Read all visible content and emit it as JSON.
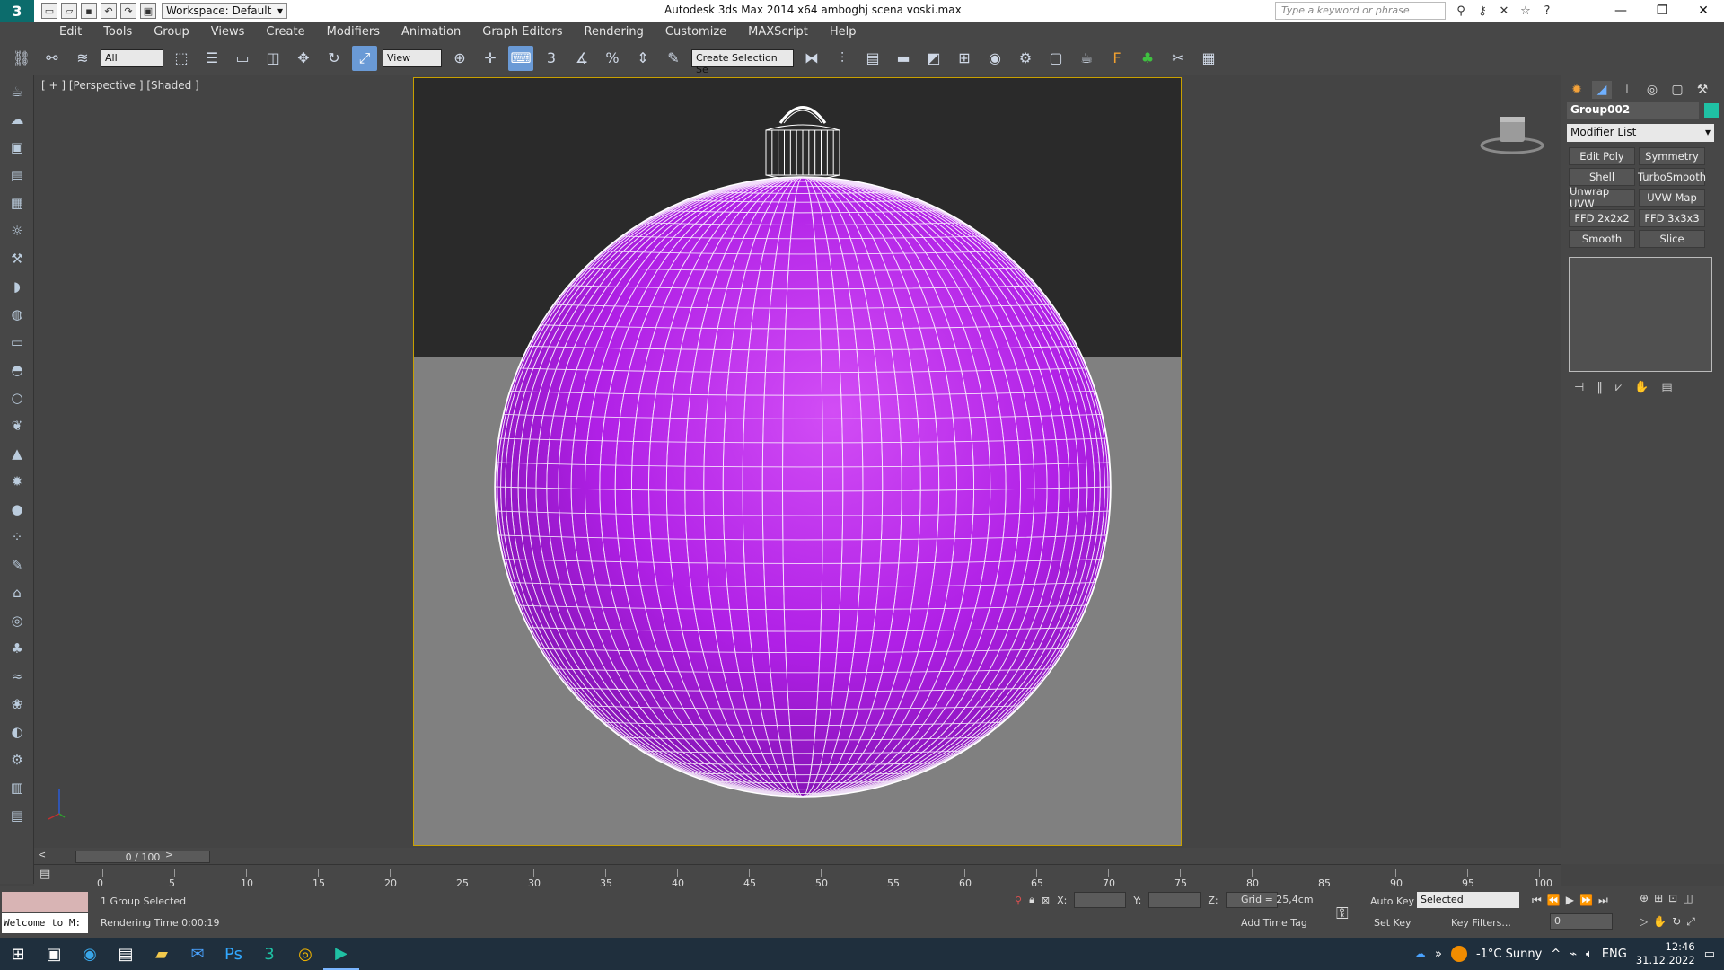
{
  "window": {
    "app_title": "Autodesk 3ds Max  2014 x64     amboghj  scena  voski.max",
    "workspace": "Workspace: Default",
    "search_placeholder": "Type a keyword or phrase"
  },
  "menu": [
    "Edit",
    "Tools",
    "Group",
    "Views",
    "Create",
    "Modifiers",
    "Animation",
    "Graph Editors",
    "Rendering",
    "Customize",
    "MAXScript",
    "Help"
  ],
  "toolbar": {
    "filter": "All",
    "ref_coord": "View",
    "named_selection": "Create Selection Se"
  },
  "viewport": {
    "label": "[ + ] [Perspective ] [Shaded ]",
    "object_color": "#b91ee6",
    "background_top": "#2a2a2a",
    "ground": "#808080"
  },
  "command_panel": {
    "object_name": "Group002",
    "object_color": "#1fc1a4",
    "modifier_list": "Modifier List",
    "modifiers": [
      "Edit Poly",
      "Symmetry",
      "Shell",
      "TurboSmooth",
      "Unwrap UVW",
      "UVW Map",
      "FFD 2x2x2",
      "FFD 3x3x3",
      "Smooth",
      "Slice"
    ]
  },
  "timeline": {
    "frame": "0 / 100",
    "ticks": [
      "0",
      "5",
      "10",
      "15",
      "20",
      "25",
      "30",
      "35",
      "40",
      "45",
      "50",
      "55",
      "60",
      "65",
      "70",
      "75",
      "80",
      "85",
      "90",
      "95",
      "100"
    ]
  },
  "status": {
    "listener_text": "Welcome to M:",
    "selection": "1 Group Selected",
    "render_time": "Rendering Time  0:00:19",
    "x_label": "X:",
    "y_label": "Y:",
    "z_label": "Z:",
    "grid": "Grid = 25,4cm",
    "add_time_tag": "Add Time Tag",
    "auto_key": "Auto Key",
    "set_key": "Set Key",
    "selected": "Selected",
    "key_filters": "Key Filters...",
    "current_frame": "0"
  },
  "taskbar": {
    "weather": "-1°C  Sunny",
    "lang": "ENG",
    "time": "12:46",
    "date": "31.12.2022"
  }
}
